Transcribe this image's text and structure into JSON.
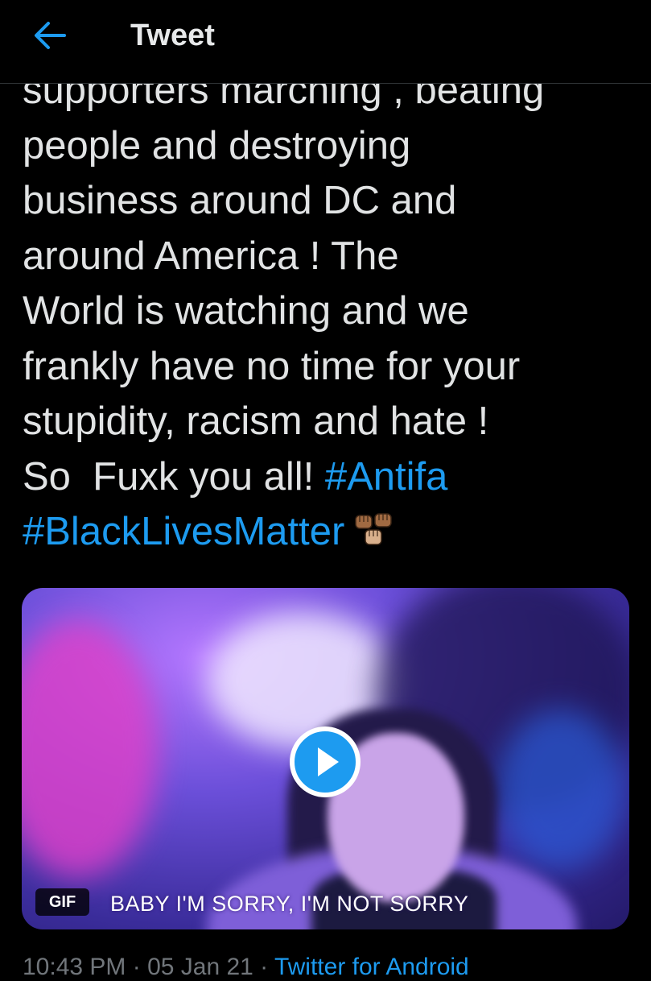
{
  "header": {
    "title": "Tweet",
    "back_icon": "arrow-left-icon",
    "accent_color": "#1d9bf0"
  },
  "tweet": {
    "lines": [
      "supporters marching , beating",
      "people and destroying",
      "business around DC and",
      "around America ! The",
      "World is watching and we",
      "frankly have no time for your",
      "stupidity, racism and hate !"
    ],
    "last_line_text": "So  Fuxk you all! ",
    "hashtags": [
      "#Antifa",
      "#BlackLivesMatter"
    ],
    "emoji": "raised-fists-emoji"
  },
  "media": {
    "badge": "GIF",
    "caption": "BABY I'M SORRY, I'M NOT SORRY",
    "play_icon": "play-icon"
  },
  "meta": {
    "timestamp": "10:43 PM · 05 Jan 21 · ",
    "source": "Twitter for Android"
  }
}
